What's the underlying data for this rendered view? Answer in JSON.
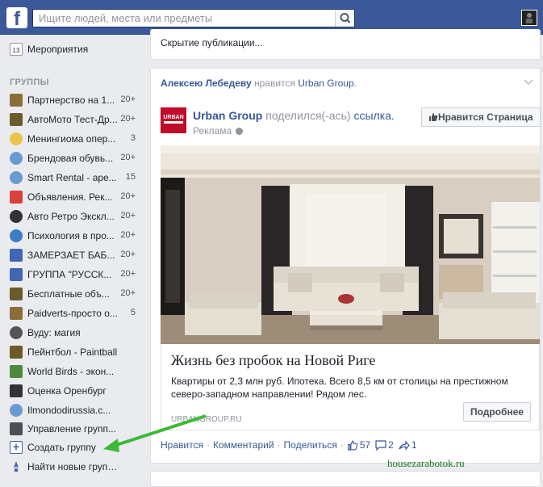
{
  "topbar": {
    "logo_letter": "f",
    "search_placeholder": "Ищите людей, места или предметы"
  },
  "sidebar": {
    "events_label": "Мероприятия",
    "events_icon_number": "13",
    "groups_title": "ГРУППЫ",
    "groups": [
      {
        "label": "Партнерство на 1...",
        "count": "20+",
        "icon": "house-icon",
        "color": "#8b6d3a"
      },
      {
        "label": "АвтоМото Тест-Др...",
        "count": "20+",
        "icon": "trophy-icon",
        "color": "#6b5a2a"
      },
      {
        "label": "Менингиома опер...",
        "count": "3",
        "icon": "lightbulb-icon",
        "color": "#e8c547"
      },
      {
        "label": "Брендовая обувь...",
        "count": "20+",
        "icon": "globe-icon",
        "color": "#6a9ad4"
      },
      {
        "label": "Smart Rental - аре...",
        "count": "15",
        "icon": "globe-icon",
        "color": "#6a9ad4"
      },
      {
        "label": "Объявления. Рек...",
        "count": "20+",
        "icon": "gift-icon",
        "color": "#d9413b"
      },
      {
        "label": "Авто Ретро Экскл...",
        "count": "20+",
        "icon": "tire-icon",
        "color": "#333333"
      },
      {
        "label": "Психология в про...",
        "count": "20+",
        "icon": "globe-icon",
        "color": "#3d7dc4"
      },
      {
        "label": "ЗАМЕРЗАЕТ БАБ...",
        "count": "20+",
        "icon": "group-icon",
        "color": "#4267b2"
      },
      {
        "label": "ГРУППА \"РУССК...",
        "count": "20+",
        "icon": "group-icon",
        "color": "#4267b2"
      },
      {
        "label": "Бесплатные объ...",
        "count": "20+",
        "icon": "trophy-icon",
        "color": "#6b5a2a"
      },
      {
        "label": "Paidverts-просто о...",
        "count": "5",
        "icon": "house-icon",
        "color": "#8b6d3a"
      },
      {
        "label": "Вуду: магия",
        "count": "",
        "icon": "skull-icon",
        "color": "#555555"
      },
      {
        "label": "Пейнтбол - Paintball",
        "count": "",
        "icon": "splat-icon",
        "color": "#6b5a2a"
      },
      {
        "label": "World Birds - экон...",
        "count": "",
        "icon": "tree-icon",
        "color": "#4a8a3a"
      },
      {
        "label": "Оценка Оренбург",
        "count": "",
        "icon": "graduation-cap-icon",
        "color": "#333333"
      },
      {
        "label": "Ilmondodirussia.c...",
        "count": "",
        "icon": "globe-icon",
        "color": "#6a9ad4"
      }
    ],
    "manage_label": "Управление групп...",
    "create_label": "Создать группу",
    "find_label": "Найти новые группы"
  },
  "hidden_post": {
    "text": "Скрытие публикации..."
  },
  "post": {
    "liker_name": "Алексею Лебедеву",
    "liked_text": "нравится",
    "liked_page": "Urban Group",
    "period": ".",
    "page_name": "Urban Group",
    "shared_text": "поделился(-ась)",
    "link_word": "ссылка.",
    "sponsored": "Реклама",
    "like_page_label": "Нравится Страница",
    "ad_title": "Жизнь без пробок на Новой Риге",
    "ad_description": "Квартиры от 2,3 млн руб. Ипотека. Всего 8,5 км от столицы на престижном северо-западном направлении! Рядом лес.",
    "ad_domain": "URBANGROUP.RU",
    "more_button": "Подробнее",
    "actions": {
      "like": "Нравится",
      "comment": "Комментарий",
      "share": "Поделиться",
      "like_count": "57",
      "comment_count": "2",
      "share_count": "1"
    }
  },
  "watermark": "housezarabotok.ru"
}
